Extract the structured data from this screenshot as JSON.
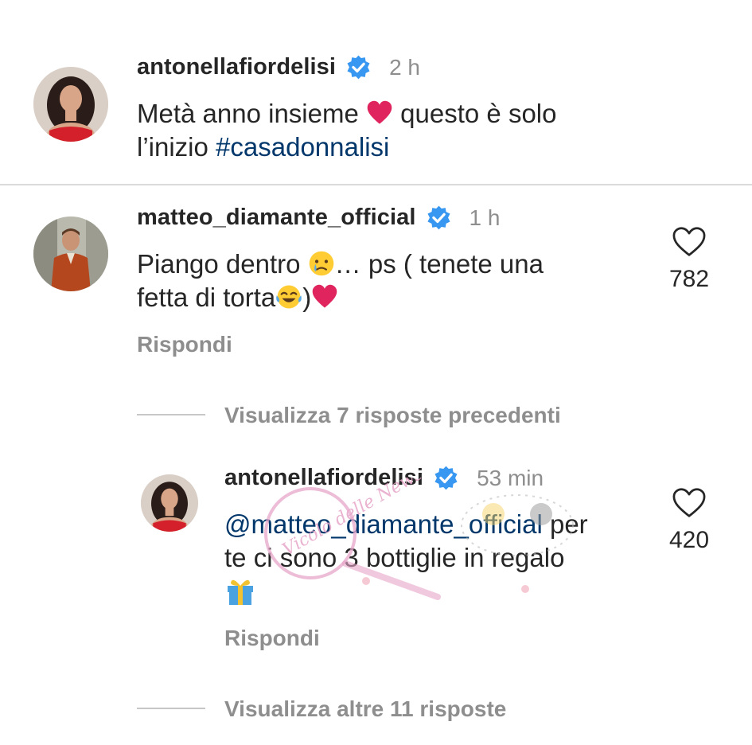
{
  "caption": {
    "username": "antonellafiordelisi",
    "time": "2 h",
    "text_before": "Metà anno insieme",
    "text_after": " questo è solo",
    "text_line2": "l’inizio ",
    "hashtag": "#casadonnalisi"
  },
  "comments": [
    {
      "username": "matteo_diamante_official",
      "time": "1 h",
      "line1": "Piango dentro",
      "line1_after": "… ps ( tenete una",
      "line2": "fetta di torta",
      "line2_after": ")",
      "likes": "782",
      "reply_label": "Rispondi"
    }
  ],
  "thread": {
    "view_previous": "Visualizza 7 risposte precedenti",
    "view_more": "Visualizza altre 11 risposte"
  },
  "reply": {
    "username": "antonellafiordelisi",
    "time": "53 min",
    "mention": "@matteo_diamante_official",
    "text_line1_after": " per",
    "text_line2": "te ci sono 3 bottiglie in regalo",
    "likes": "420",
    "reply_label": "Rispondi"
  },
  "watermark": {
    "text": "Vicolo delle News"
  },
  "colors": {
    "text": "#262626",
    "secondary": "#8e8e8e",
    "link": "#00376b",
    "verified": "#3897f0",
    "divider": "#dbdbdb",
    "heart_red": "#e0245e"
  },
  "icons": [
    "verified-badge-icon",
    "heart-outline-icon",
    "red-heart-emoji",
    "crying-face-emoji",
    "tears-of-joy-emoji",
    "gift-emoji"
  ]
}
